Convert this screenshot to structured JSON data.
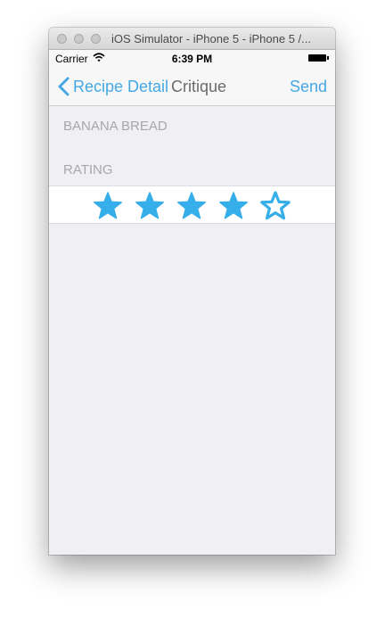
{
  "window": {
    "title": "iOS Simulator - iPhone 5 - iPhone 5 /..."
  },
  "status_bar": {
    "carrier": "Carrier",
    "time": "6:39 PM"
  },
  "nav_bar": {
    "back_label": "Recipe Detail",
    "title": "Critique",
    "action_label": "Send",
    "tint_color": "#45a8e4"
  },
  "recipe_section": {
    "header": "BANANA BREAD"
  },
  "rating_section": {
    "header": "RATING",
    "rating": 4,
    "max_rating": 5,
    "star_color": "#35aee9"
  }
}
